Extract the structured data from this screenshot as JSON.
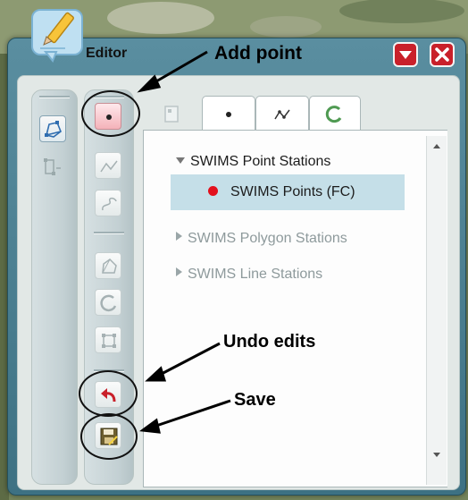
{
  "window": {
    "title": "Editor",
    "accent_color": "#c9202a",
    "app_icon": "pencil-note-icon",
    "collapse_icon": "chevron-down-icon",
    "close_icon": "close-icon"
  },
  "tools_left": [
    "reshape-polygon-icon",
    "vertices-icon"
  ],
  "tools_right": [
    "point-icon",
    "polyline-icon",
    "freehand-line-icon",
    "polygon-icon",
    "autocomplete-polygon-icon",
    "extent-icon",
    "undo-icon",
    "save-icon"
  ],
  "tabs": [
    "layers-tab-icon",
    "point-tab-icon",
    "line-tab-icon",
    "polygon-tab-icon"
  ],
  "tree": {
    "group1": "SWIMS Point Stations",
    "item1": "SWIMS Points (FC)",
    "item1_color": "#e3101c",
    "group2": "SWIMS Polygon Stations",
    "group3": "SWIMS Line Stations"
  },
  "callouts": {
    "add_point": "Add point",
    "undo_edits": "Undo edits",
    "save": "Save"
  }
}
